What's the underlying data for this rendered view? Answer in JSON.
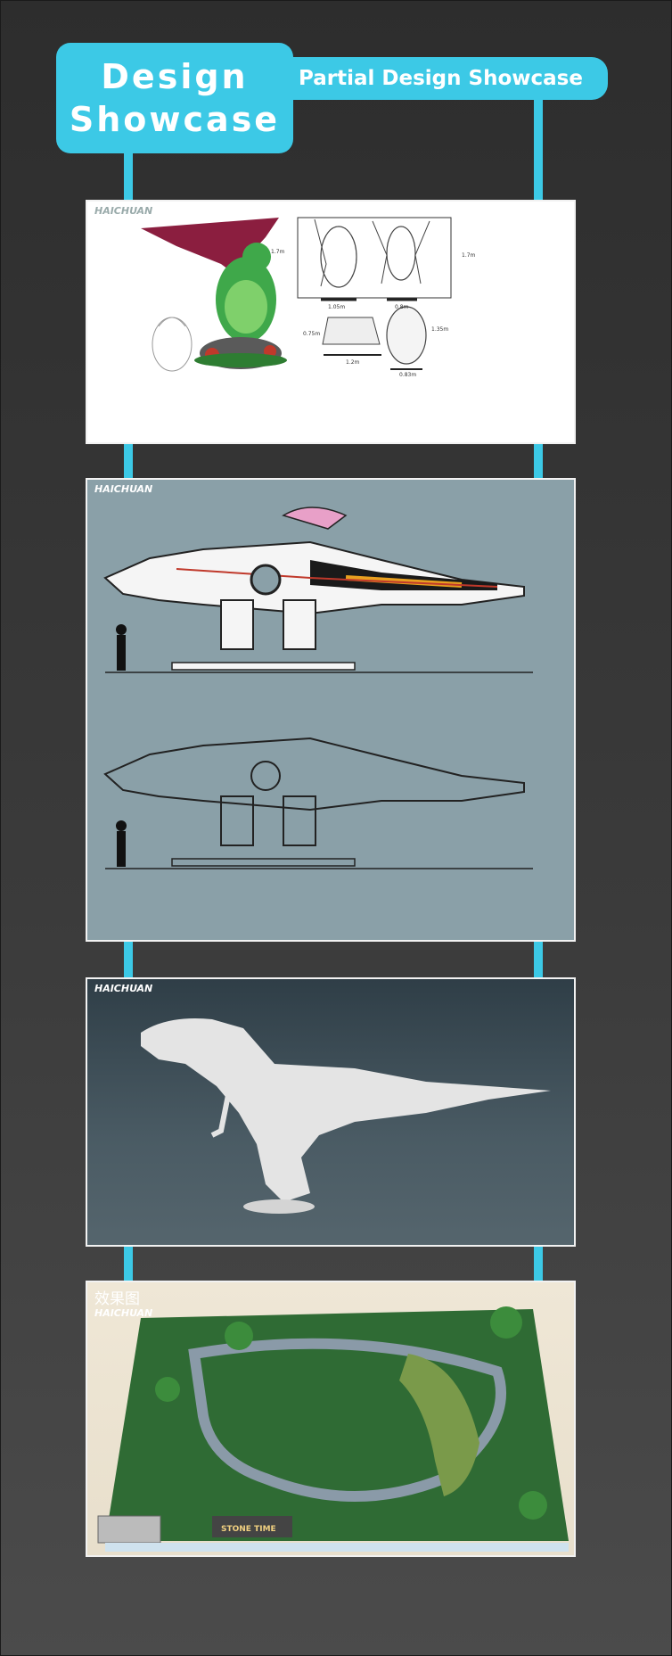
{
  "header": {
    "title_line1": "Design",
    "title_line2": "Showcase",
    "subtitle": "Partial Design Showcase"
  },
  "panels": {
    "dragon": {
      "logo": "HAICHUAN",
      "dims": [
        "1.7m",
        "1.05m",
        "0.8m",
        "1.7m",
        "0.75m",
        "1.2m",
        "1.35m",
        "0.83m"
      ]
    },
    "mech": {
      "logo": "HAICHUAN"
    },
    "trex": {
      "logo": "HAICHUAN"
    },
    "park": {
      "label": "效果图",
      "logo": "HAICHUAN",
      "sign": "STONE TIME"
    }
  },
  "colors": {
    "accent": "#3cc9e6",
    "background": "#3a3a3a"
  }
}
